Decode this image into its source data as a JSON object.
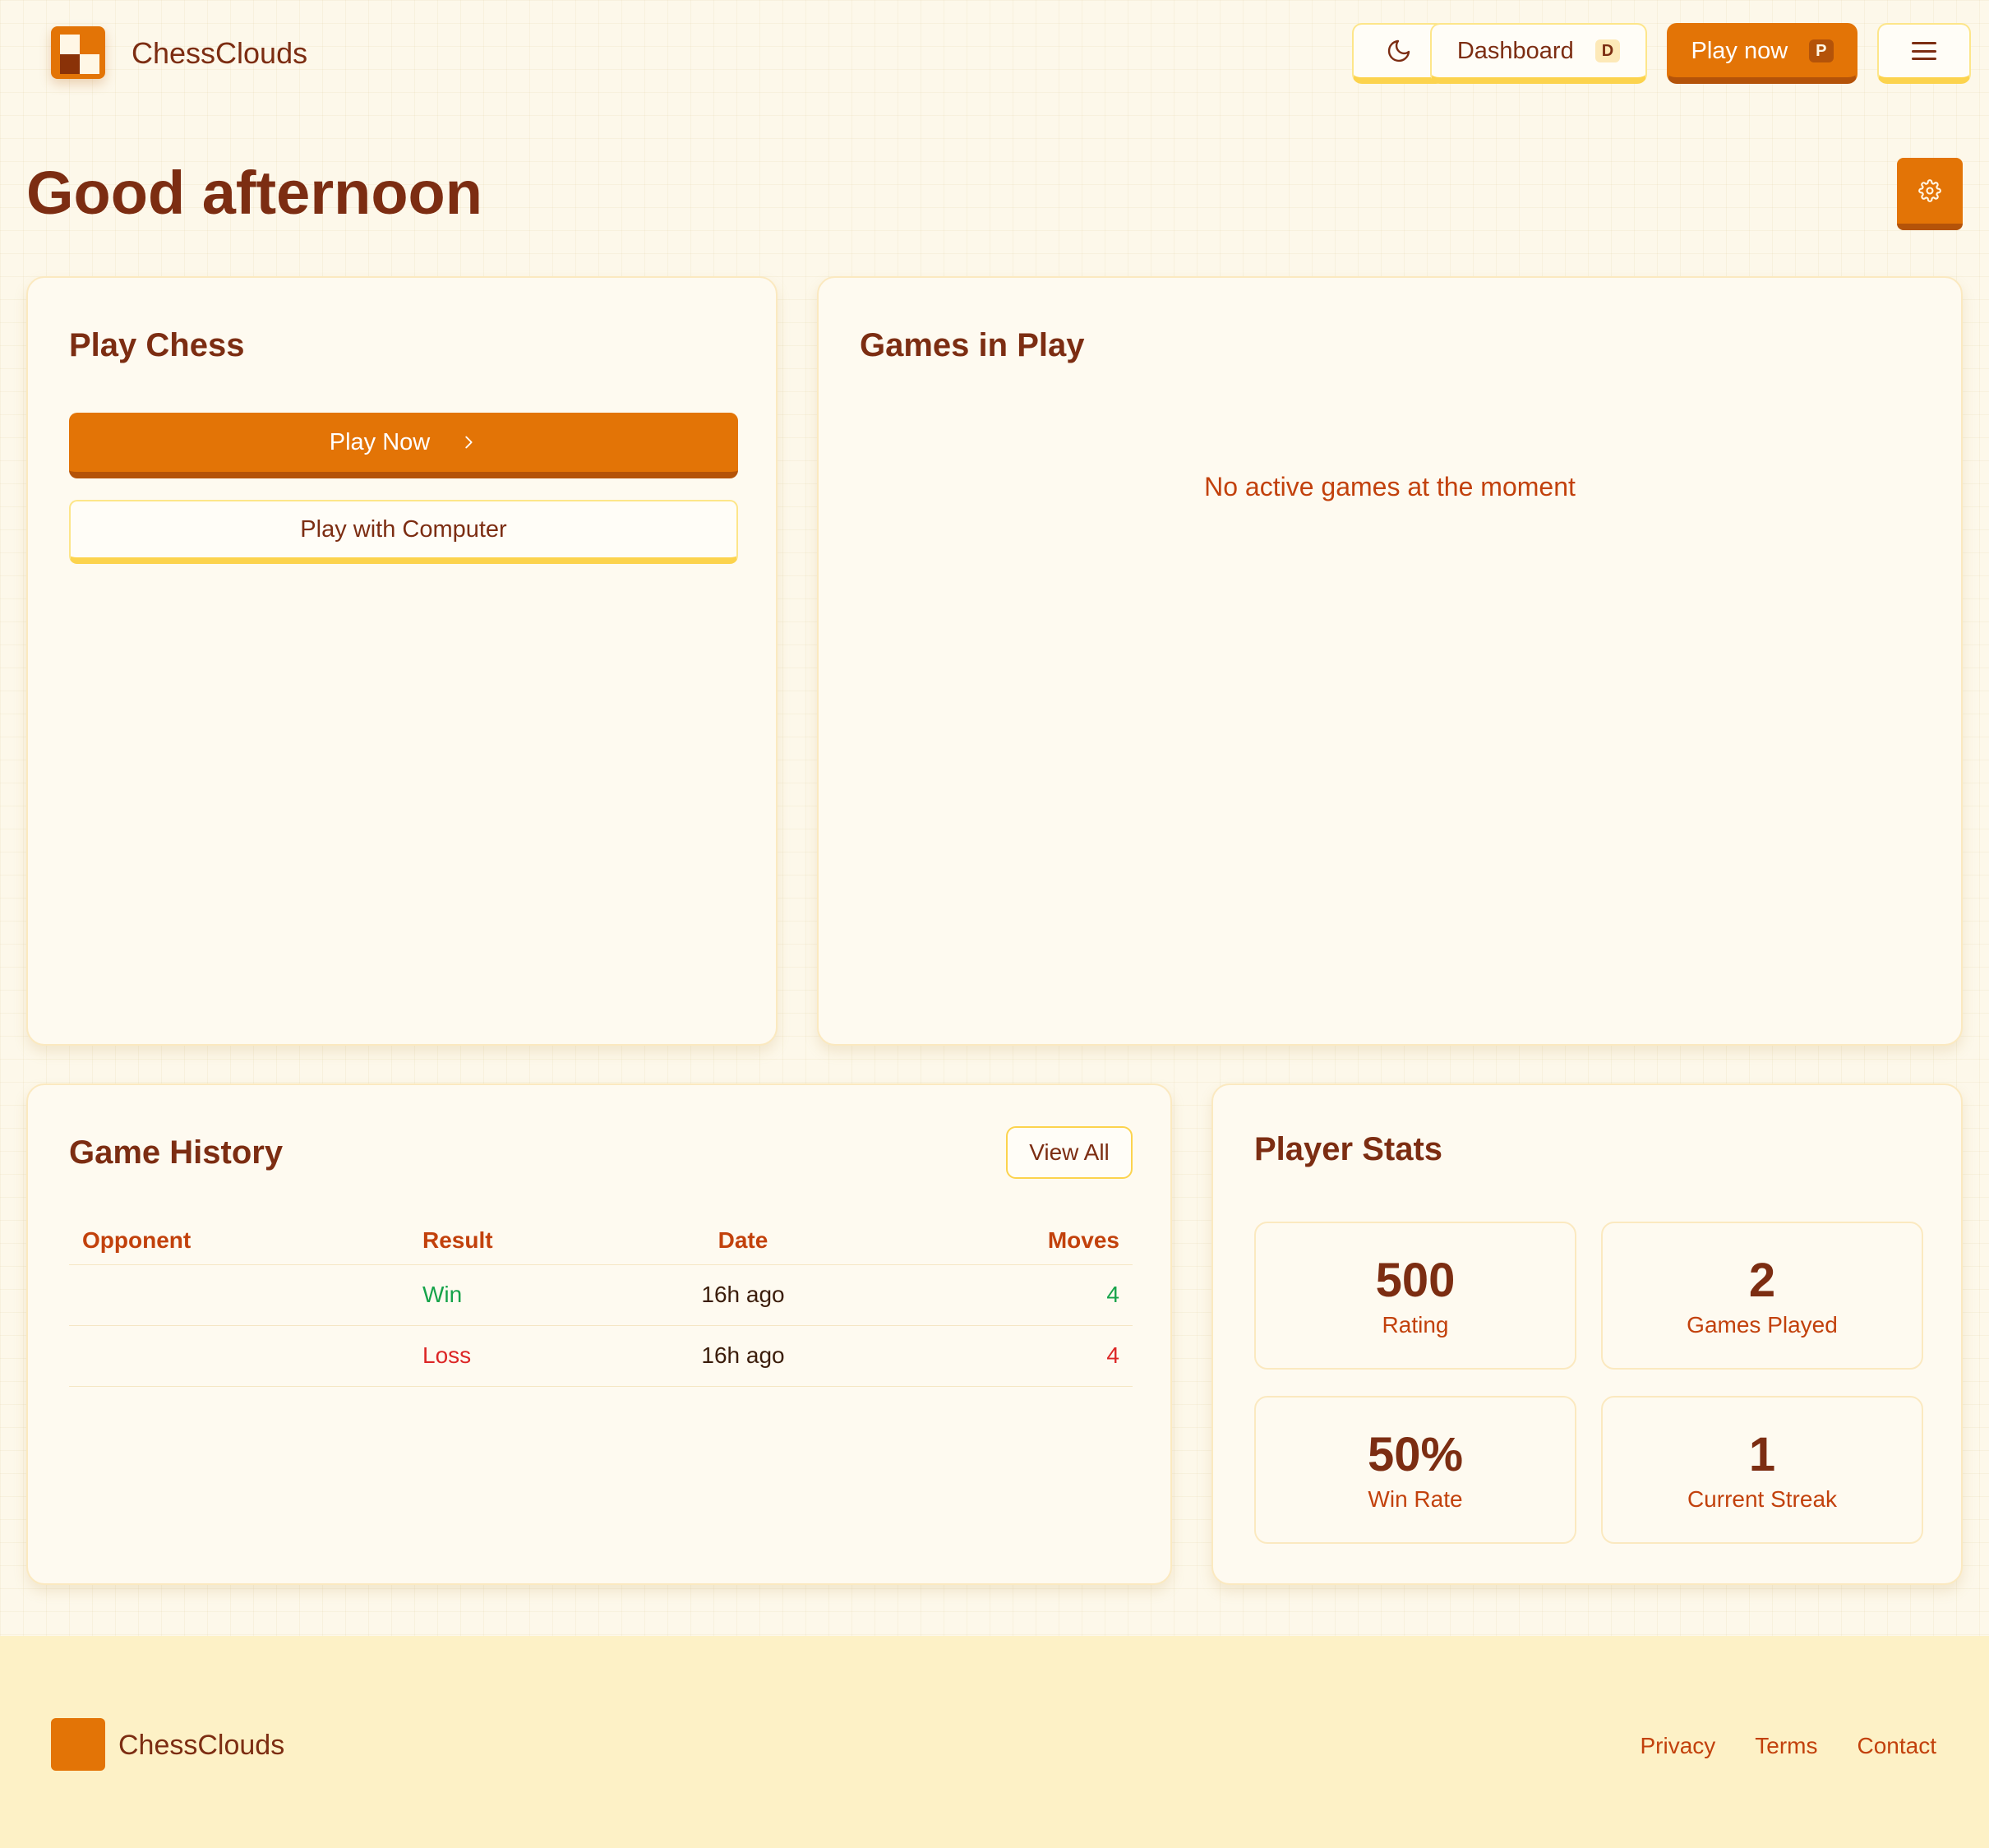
{
  "header": {
    "brand": "ChessClouds",
    "theme_icon": "moon-icon",
    "dashboard_label": "Dashboard",
    "dashboard_shortcut": "D",
    "play_label": "Play now",
    "play_shortcut": "P",
    "menu_icon": "hamburger-menu-icon"
  },
  "greeting": "Good afternoon",
  "settings_icon": "gear-icon",
  "play_card": {
    "title": "Play Chess",
    "play_now_label": "Play Now",
    "play_computer_label": "Play with Computer"
  },
  "games_card": {
    "title": "Games in Play",
    "empty_message": "No active games at the moment"
  },
  "history": {
    "title": "Game History",
    "view_all_label": "View All",
    "columns": [
      "Opponent",
      "Result",
      "Date",
      "Moves"
    ],
    "rows": [
      {
        "opponent": "",
        "result": "Win",
        "date": "16h ago",
        "moves": "4"
      },
      {
        "opponent": "",
        "result": "Loss",
        "date": "16h ago",
        "moves": "4"
      }
    ]
  },
  "stats": {
    "title": "Player Stats",
    "items": [
      {
        "value": "500",
        "label": "Rating"
      },
      {
        "value": "2",
        "label": "Games Played"
      },
      {
        "value": "50%",
        "label": "Win Rate"
      },
      {
        "value": "1",
        "label": "Current Streak"
      }
    ]
  },
  "footer": {
    "brand": "ChessClouds",
    "links": [
      "Privacy",
      "Terms",
      "Contact"
    ]
  },
  "colors": {
    "accent": "#e37406",
    "accent_dark": "#b45309",
    "text": "#7c2d12",
    "win": "#16a34a",
    "loss": "#dc2626",
    "background": "#fdf8ea",
    "footer_bg": "#fdf1c6"
  }
}
